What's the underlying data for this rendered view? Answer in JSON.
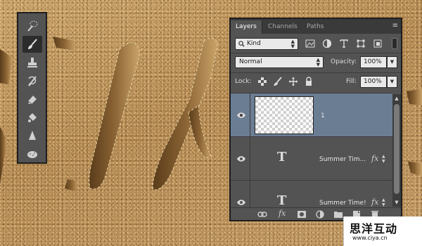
{
  "toolbox": {
    "tools": [
      {
        "name": "quick-selection",
        "icon": "quick-selection-icon",
        "active": false
      },
      {
        "name": "brush",
        "icon": "brush-icon",
        "active": true
      },
      {
        "name": "clone-stamp",
        "icon": "clone-stamp-icon",
        "active": false
      },
      {
        "name": "history-brush",
        "icon": "history-brush-icon",
        "active": false
      },
      {
        "name": "eraser",
        "icon": "eraser-icon",
        "active": false
      },
      {
        "name": "paint-bucket",
        "icon": "paint-bucket-icon",
        "active": false
      },
      {
        "name": "blur",
        "icon": "blur-icon",
        "active": false
      },
      {
        "name": "sponge",
        "icon": "sponge-icon",
        "active": false
      }
    ]
  },
  "panel": {
    "tabs": [
      "Layers",
      "Channels",
      "Paths"
    ],
    "active_tab": "Layers",
    "menu_icon": "panel-menu-icon",
    "filter": {
      "label": "Kind"
    },
    "blend_mode": "Normal",
    "opacity_label": "Opacity:",
    "opacity_value": "100%",
    "lock_label": "Lock:",
    "fill_label": "Fill:",
    "fill_value": "100%",
    "layers": [
      {
        "name": "1",
        "type": "pixel",
        "selected": true,
        "visible": true,
        "fx": false
      },
      {
        "name": "Summer Tim...",
        "type": "text",
        "selected": false,
        "visible": true,
        "fx": true
      },
      {
        "name": "Summer Time!",
        "type": "text",
        "selected": false,
        "visible": true,
        "fx": true
      }
    ],
    "fx_label": "fx",
    "text_thumb_glyph": "T"
  },
  "watermark": {
    "title": "思洋互动",
    "url": "www.ciya.cn"
  },
  "colors": {
    "panel_bg": "#535353",
    "selected_layer": "#6b7d93",
    "sand": "#b88f57"
  }
}
